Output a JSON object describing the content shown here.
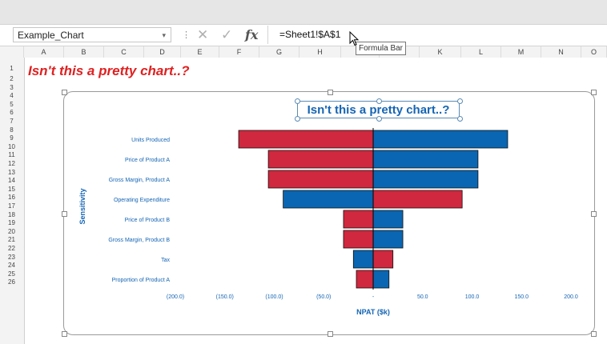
{
  "formula_bar": {
    "name_box": "Example_Chart",
    "name_box_dropdown": "▾",
    "separator": "⋮",
    "cancel_glyph": "✕",
    "enter_glyph": "✓",
    "fx_label": "fx",
    "formula": "=Sheet1!$A$1",
    "tooltip": "Formula Bar"
  },
  "columns": [
    "A",
    "B",
    "C",
    "D",
    "E",
    "F",
    "G",
    "H",
    "I",
    "J",
    "K",
    "L",
    "M",
    "N",
    "O"
  ],
  "rows": [
    "1",
    "2",
    "3",
    "4",
    "5",
    "6",
    "7",
    "8",
    "9",
    "10",
    "11",
    "12",
    "13",
    "14",
    "15",
    "16",
    "17",
    "18",
    "19",
    "20",
    "21",
    "22",
    "23",
    "24",
    "25",
    "26"
  ],
  "cell_a1": "Isn't this a pretty chart..?",
  "colors": {
    "red": "#d0283e",
    "blue": "#0a66b2",
    "label_blue": "#1565b4",
    "a1_red": "#e02020"
  },
  "chart_data": {
    "type": "bar",
    "orientation": "horizontal",
    "style": "tornado",
    "title": "Isn't this a pretty chart..?",
    "xlabel": "NPAT ($k)",
    "ylabel": "Sensitivity",
    "xlim": [
      -200,
      200
    ],
    "xticks": [
      "(200.0)",
      "(150.0)",
      "(100.0)",
      "(50.0)",
      "-",
      "50.0",
      "100.0",
      "150.0",
      "200.0"
    ],
    "categories": [
      "Units Produced",
      "Price of Product A",
      "Gross Margin, Product A",
      "Operating Expenditure",
      "Price of Product B",
      "Gross Margin, Product B",
      "Tax",
      "Proportion of Product A"
    ],
    "series": [
      {
        "color": "#d0283e",
        "values": [
          -136,
          -106,
          -106,
          90,
          -30,
          -30,
          20,
          -17
        ]
      },
      {
        "color": "#0a66b2",
        "values": [
          136,
          106,
          106,
          -91,
          30,
          30,
          -20,
          16
        ]
      }
    ]
  }
}
